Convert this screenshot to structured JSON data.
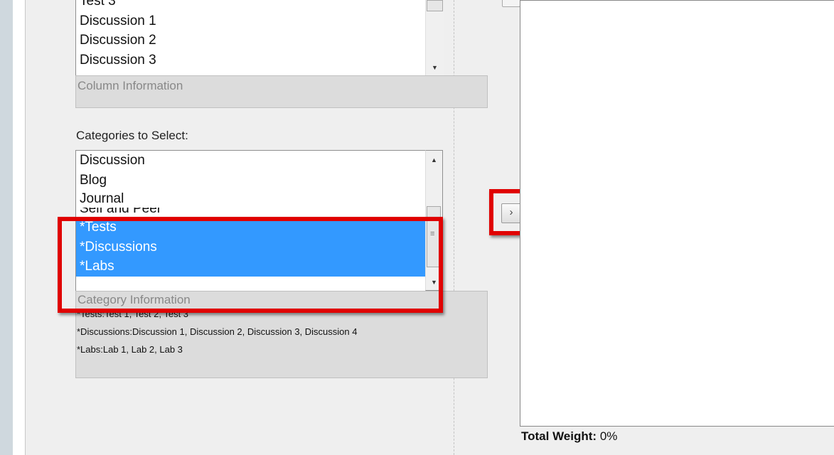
{
  "columns_list": {
    "items": [
      "Test 3",
      "Discussion 1",
      "Discussion 2",
      "Discussion 3"
    ]
  },
  "column_info": {
    "title": "Column Information"
  },
  "categories": {
    "label": "Categories to Select:",
    "items": [
      {
        "label": "Discussion",
        "selected": false
      },
      {
        "label": "Blog",
        "selected": false
      },
      {
        "label": "Journal",
        "selected": false
      },
      {
        "label": "Self and Peer",
        "selected": false
      },
      {
        "label": "*Tests",
        "selected": true
      },
      {
        "label": "*Discussions",
        "selected": true
      },
      {
        "label": "*Labs",
        "selected": true
      }
    ]
  },
  "category_info": {
    "title": "Category Information",
    "lines": [
      "*Tests:Test 1, Test 2, Test 3",
      "*Discussions:Discussion 1, Discussion 2, Discussion 3, Discussion 4",
      "*Labs:Lab 1, Lab 2, Lab 3"
    ]
  },
  "move_button": {
    "glyph": "›"
  },
  "total_weight": {
    "label": "Total Weight:",
    "value": "0%"
  },
  "colors": {
    "selection": "#3399ff",
    "highlight": "#e00000"
  }
}
